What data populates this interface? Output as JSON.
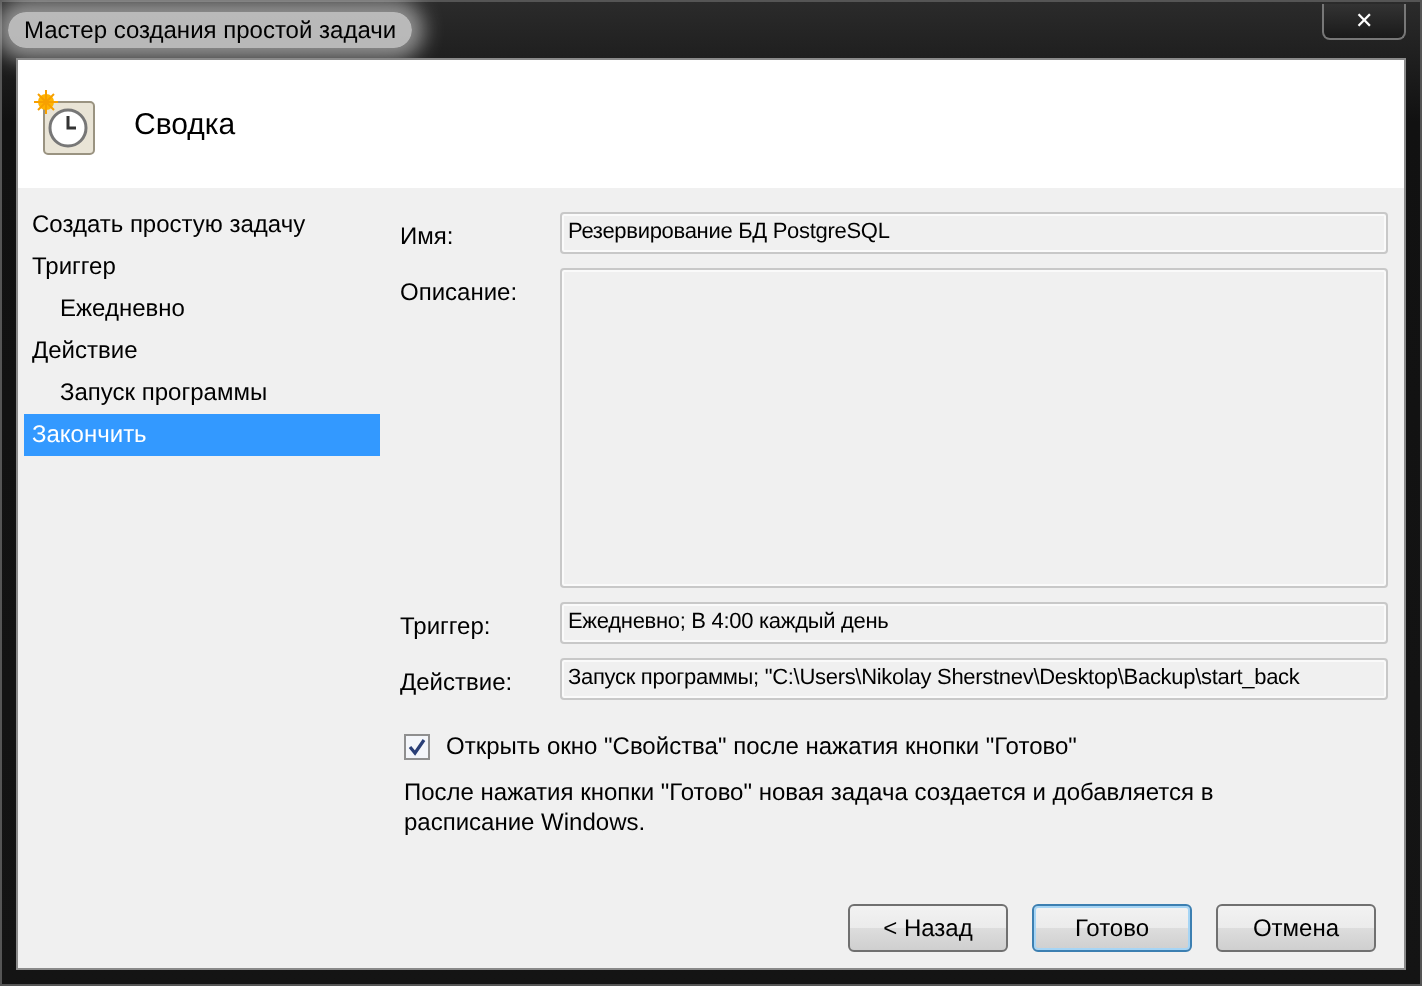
{
  "window": {
    "title": "Мастер создания простой задачи",
    "close": "✕"
  },
  "header": {
    "title": "Сводка"
  },
  "sidebar": {
    "items": [
      {
        "label": "Создать простую задачу",
        "selected": false
      },
      {
        "label": "Триггер",
        "selected": false,
        "children": [
          {
            "label": "Ежедневно",
            "selected": false
          }
        ]
      },
      {
        "label": "Действие",
        "selected": false,
        "children": [
          {
            "label": "Запуск программы",
            "selected": false
          }
        ]
      },
      {
        "label": "Закончить",
        "selected": true
      }
    ]
  },
  "fields": [
    {
      "kind": "line",
      "label": "Имя:",
      "value": "Резервирование БД PostgreSQL"
    },
    {
      "kind": "area",
      "label": "Описание:"
    },
    {
      "kind": "line",
      "label": "Триггер:",
      "value": "Ежедневно; В 4:00 каждый день"
    },
    {
      "kind": "line",
      "label": "Действие:",
      "value": "Запуск программы; \"C:\\Users\\Nikolay Sherstnev\\Desktop\\Backup\\start_back"
    }
  ],
  "open_properties": {
    "label": "Открыть окно \"Свойства\" после нажатия кнопки \"Готово\"",
    "checked": true
  },
  "note": "После нажатия кнопки \"Готово\" новая задача создается и добавляется в расписание Windows.",
  "buttons": [
    {
      "label": "< Назад",
      "selected": false
    },
    {
      "label": "Готово",
      "selected": true
    },
    {
      "label": "Отмена",
      "selected": false
    }
  ]
}
